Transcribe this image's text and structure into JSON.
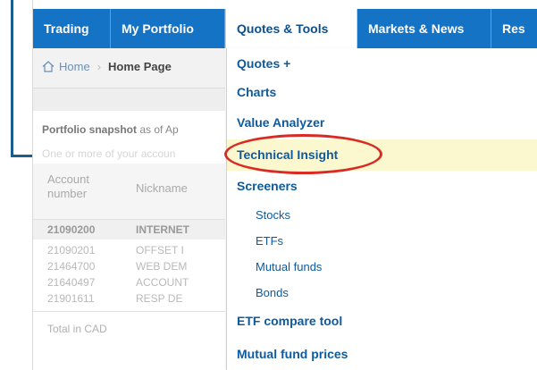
{
  "nav": {
    "tabs": [
      {
        "label": "Trading"
      },
      {
        "label": "My Portfolio"
      },
      {
        "label": "Quotes & Tools"
      },
      {
        "label": "Markets & News"
      },
      {
        "label": "Res"
      }
    ]
  },
  "breadcrumb": {
    "home": "Home",
    "current": "Home Page"
  },
  "portfolio": {
    "snapshot_bold": "Portfolio snapshot",
    "snapshot_rest": " as of  Ap",
    "note": "One or more of your accoun",
    "header_account": "Account number",
    "header_nickname": "Nickname",
    "rows": [
      {
        "account": "21090200",
        "nickname": "INTERNET"
      },
      {
        "account": "21090201",
        "nickname": "OFFSET I"
      },
      {
        "account": "21464700",
        "nickname": "WEB DEM"
      },
      {
        "account": "21640497",
        "nickname": "ACCOUNT"
      },
      {
        "account": "21901611",
        "nickname": "RESP DE"
      }
    ],
    "total": "Total in CAD"
  },
  "menu": {
    "items": [
      {
        "label": "Quotes +"
      },
      {
        "label": "Charts"
      },
      {
        "label": "Value Analyzer"
      },
      {
        "label": "Technical Insight"
      },
      {
        "label": "Screeners"
      },
      {
        "label": "Stocks"
      },
      {
        "label": "ETFs"
      },
      {
        "label": "Mutual funds"
      },
      {
        "label": "Bonds"
      },
      {
        "label": "ETF compare tool"
      },
      {
        "label": "Mutual fund prices"
      }
    ]
  },
  "colors": {
    "nav_blue": "#1473c4",
    "link_blue": "#0d5a9e",
    "highlight": "#fbf8cf",
    "circle_red": "#d92b25",
    "callout": "#1b5e8c"
  }
}
